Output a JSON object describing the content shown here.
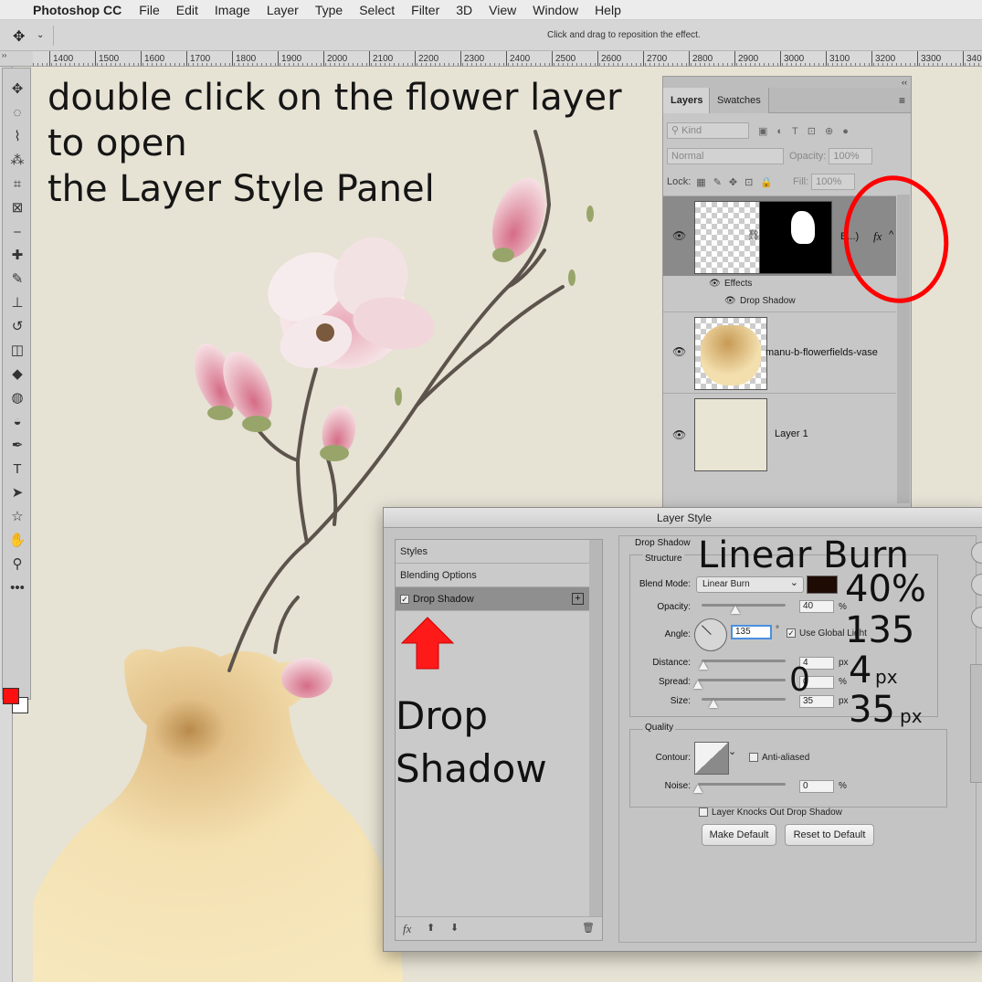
{
  "menubar": {
    "app_name": "Photoshop CC",
    "items": [
      "File",
      "Edit",
      "Image",
      "Layer",
      "Type",
      "Select",
      "Filter",
      "3D",
      "View",
      "Window",
      "Help"
    ]
  },
  "options_bar": {
    "hint": "Click and drag to reposition the effect."
  },
  "ruler": {
    "ticks": [
      "1400",
      "1500",
      "1600",
      "1700",
      "1800",
      "1900",
      "2000",
      "2100",
      "2200",
      "2300",
      "2400",
      "2500",
      "2600",
      "2700",
      "2800",
      "2900",
      "3000",
      "3100",
      "3200",
      "3300",
      "340"
    ]
  },
  "tools": [
    "move-icon",
    "marquee-icon",
    "lasso-icon",
    "magic-wand-icon",
    "crop-icon",
    "frame-icon",
    "eyedropper-icon",
    "healing-icon",
    "brush-icon",
    "stamp-icon",
    "history-brush-icon",
    "eraser-icon",
    "bucket-icon",
    "blur-icon",
    "dodge-icon",
    "pen-icon",
    "type-icon",
    "path-select-icon",
    "shape-icon",
    "hand-icon",
    "zoom-icon",
    "more-icon"
  ],
  "tool_glyphs": [
    "✥",
    "◌",
    "⌇",
    "⁂",
    "⌗",
    "⊠",
    "⎯",
    "✚",
    "✎",
    "⊥",
    "↺",
    "◫",
    "◆",
    "◍",
    "◒",
    "✒",
    "T",
    "➤",
    "☆",
    "✋",
    "⚲",
    "•••"
  ],
  "colors": {
    "foreground": "#ff1010",
    "background": "#ffffff",
    "annotation_circle": "#ff0000",
    "arrow": "#ff1a1a",
    "shadow_swatch": "#1e0c04"
  },
  "instruction": "double click on the flower layer\nto open\nthe Layer Style Panel",
  "layers_panel": {
    "tab_layers": "Layers",
    "tab_swatches": "Swatches",
    "filter_kind": "Kind",
    "blend_mode": "Normal",
    "opacity_label": "Opacity:",
    "opacity_value": "100%",
    "lock_label": "Lock:",
    "fill_label": "Fill:",
    "fill_value": "100%",
    "layers": [
      {
        "name": "B...)",
        "fx": "fx",
        "effects_label": "Effects",
        "effect": "Drop Shadow"
      },
      {
        "name": "manu-b-flowerfields-vase"
      },
      {
        "name": "Layer 1"
      }
    ]
  },
  "dialog": {
    "title": "Layer Style",
    "list": [
      "Styles",
      "Blending Options",
      "Drop Shadow"
    ],
    "list_bottom": {
      "fx": "fx"
    },
    "section": "Drop Shadow",
    "structure": "Structure",
    "blend_mode_label": "Blend Mode:",
    "blend_mode": "Linear Burn",
    "opacity_label": "Opacity:",
    "opacity": "40",
    "angle_label": "Angle:",
    "angle": "135",
    "degree": "°",
    "use_global_light": "Use Global Light",
    "distance_label": "Distance:",
    "distance": "4",
    "spread_label": "Spread:",
    "spread": "0",
    "size_label": "Size:",
    "size": "35",
    "unit_px": "px",
    "unit_pct": "%",
    "quality": "Quality",
    "contour_label": "Contour:",
    "anti_aliased": "Anti-aliased",
    "noise_label": "Noise:",
    "noise": "0",
    "knockout": "Layer Knocks Out Drop Shadow",
    "make_default": "Make Default",
    "reset_default": "Reset to Default",
    "slider_levels": {
      "opacity": 0.4,
      "distance": 0.02,
      "spread": 0.0,
      "size": 0.14,
      "noise": 0.0
    }
  },
  "annotations": {
    "blend": "Linear Burn",
    "opacity": "40%",
    "angle": "135",
    "distance": "4",
    "spread": "0",
    "size": "35",
    "px": "px",
    "drop_shadow": "Drop\nShadow"
  }
}
